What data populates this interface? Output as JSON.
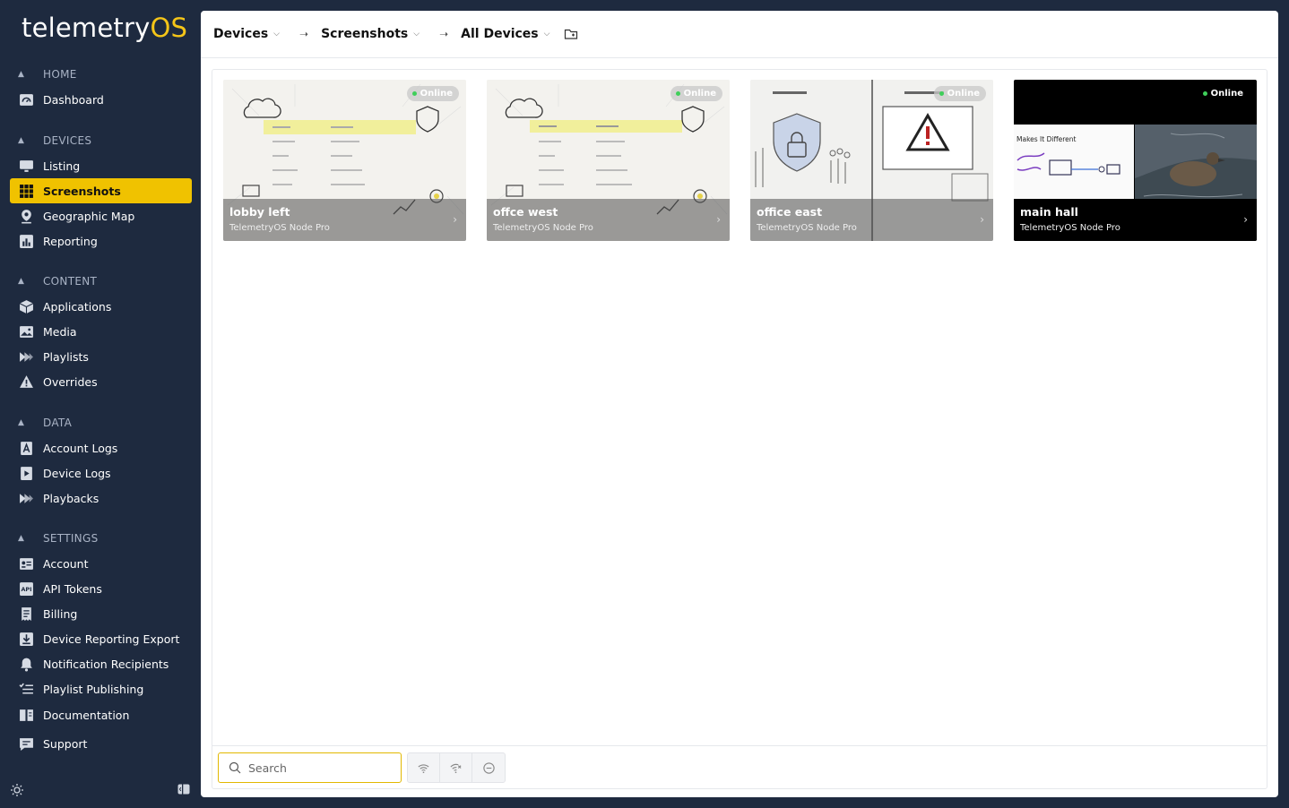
{
  "app": {
    "logo_main": "telemetry",
    "logo_accent": "OS"
  },
  "sidebar": {
    "sections": [
      {
        "title": "HOME",
        "items": [
          {
            "label": "Dashboard",
            "icon": "dashboard-icon"
          }
        ]
      },
      {
        "title": "DEVICES",
        "items": [
          {
            "label": "Listing",
            "icon": "monitor-icon"
          },
          {
            "label": "Screenshots",
            "icon": "grid-icon",
            "active": true
          },
          {
            "label": "Geographic Map",
            "icon": "map-pin-icon"
          },
          {
            "label": "Reporting",
            "icon": "bar-chart-icon"
          }
        ]
      },
      {
        "title": "CONTENT",
        "items": [
          {
            "label": "Applications",
            "icon": "box-icon"
          },
          {
            "label": "Media",
            "icon": "image-icon"
          },
          {
            "label": "Playlists",
            "icon": "playlist-icon"
          },
          {
            "label": "Overrides",
            "icon": "warning-icon"
          }
        ]
      },
      {
        "title": "DATA",
        "items": [
          {
            "label": "Account Logs",
            "icon": "account-log-icon"
          },
          {
            "label": "Device Logs",
            "icon": "device-log-icon"
          },
          {
            "label": "Playbacks",
            "icon": "playback-icon"
          }
        ]
      },
      {
        "title": "SETTINGS",
        "items": [
          {
            "label": "Account",
            "icon": "id-card-icon"
          },
          {
            "label": "API Tokens",
            "icon": "api-icon"
          },
          {
            "label": "Billing",
            "icon": "receipt-icon"
          },
          {
            "label": "Device Reporting Export",
            "icon": "download-icon"
          },
          {
            "label": "Notification Recipients",
            "icon": "bell-icon"
          },
          {
            "label": "Playlist Publishing",
            "icon": "list-check-icon"
          }
        ]
      }
    ],
    "footer_items": [
      {
        "label": "Documentation",
        "icon": "book-icon"
      },
      {
        "label": "Support",
        "icon": "chat-icon"
      }
    ]
  },
  "breadcrumb": {
    "items": [
      "Devices",
      "Screenshots",
      "All Devices"
    ]
  },
  "devices": [
    {
      "name": "lobby left",
      "model": "TelemetryOS Node Pro",
      "status": "Online",
      "theme": "light-diagram"
    },
    {
      "name": "offce west",
      "model": "TelemetryOS Node Pro",
      "status": "Online",
      "theme": "light-diagram"
    },
    {
      "name": "office east",
      "model": "TelemetryOS Node Pro",
      "status": "Online",
      "theme": "security"
    },
    {
      "name": "main hall",
      "model": "TelemetryOS Node Pro",
      "status": "Online",
      "theme": "dark-duck",
      "caption": "Makes It Different"
    }
  ],
  "filter": {
    "search_placeholder": "Search",
    "buttons": [
      "online-filter",
      "offline-filter",
      "disabled-filter"
    ]
  },
  "colors": {
    "sidebar_bg": "#1e2a3f",
    "accent": "#f0c200",
    "online": "#3fcf5a"
  }
}
